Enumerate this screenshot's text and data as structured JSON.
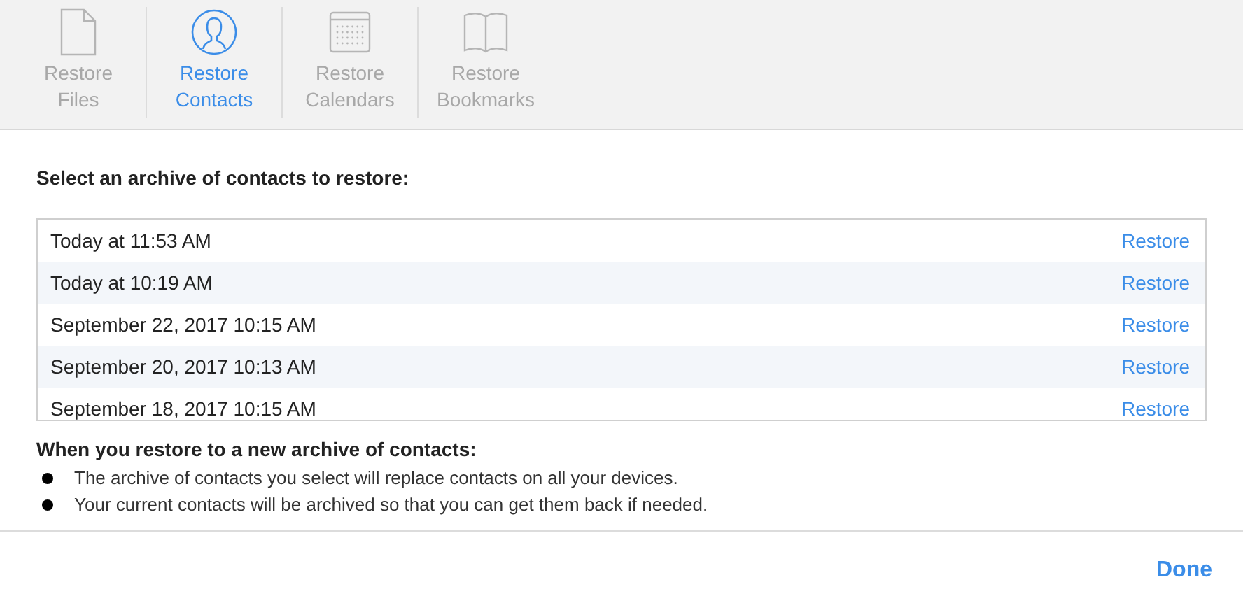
{
  "tabs": [
    {
      "kind": "file",
      "label": [
        "Restore",
        "Files"
      ],
      "selected": false
    },
    {
      "kind": "contact",
      "label": [
        "Restore",
        "Contacts"
      ],
      "selected": true
    },
    {
      "kind": "calendar",
      "label": [
        "Restore",
        "Calendars"
      ],
      "selected": false
    },
    {
      "kind": "bookmark",
      "label": [
        "Restore",
        "Bookmarks"
      ],
      "selected": false
    }
  ],
  "heading": "Select an archive of contacts to restore:",
  "archives": [
    {
      "date": "Today at 11:53 AM",
      "action": "Restore"
    },
    {
      "date": "Today at 10:19 AM",
      "action": "Restore"
    },
    {
      "date": "September 22, 2017 10:15 AM",
      "action": "Restore"
    },
    {
      "date": "September 20, 2017 10:13 AM",
      "action": "Restore"
    },
    {
      "date": "September 18, 2017 10:15 AM",
      "action": "Restore"
    }
  ],
  "notes_title": "When you restore to a new archive of contacts:",
  "notes": [
    "The archive of contacts you select will replace contacts on all your devices.",
    "Your current contacts will be archived so that you can get them back if needed."
  ],
  "done": "Done"
}
